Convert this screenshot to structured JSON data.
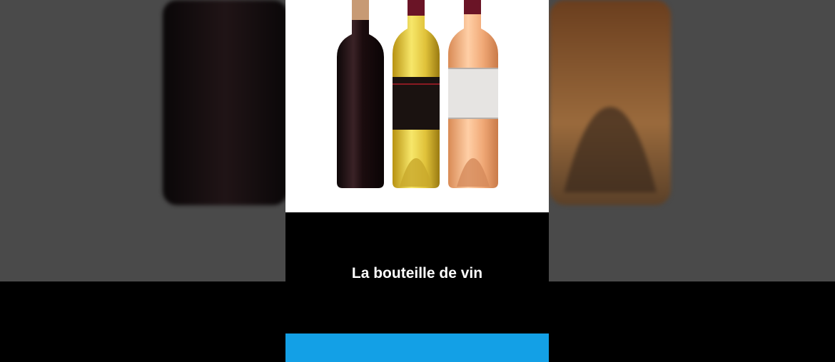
{
  "caption": "La bouteille de vin",
  "colors": {
    "background_dim": "#4a4a4a",
    "photo_background": "#ffffff",
    "accent_bar": "#13a0e6",
    "red_wine": "#1a0d0f",
    "white_wine": "#e6c83a",
    "rose_wine": "#f2b07e"
  },
  "bottles": [
    "red-wine-bottle",
    "white-wine-bottle",
    "rose-wine-bottle"
  ]
}
